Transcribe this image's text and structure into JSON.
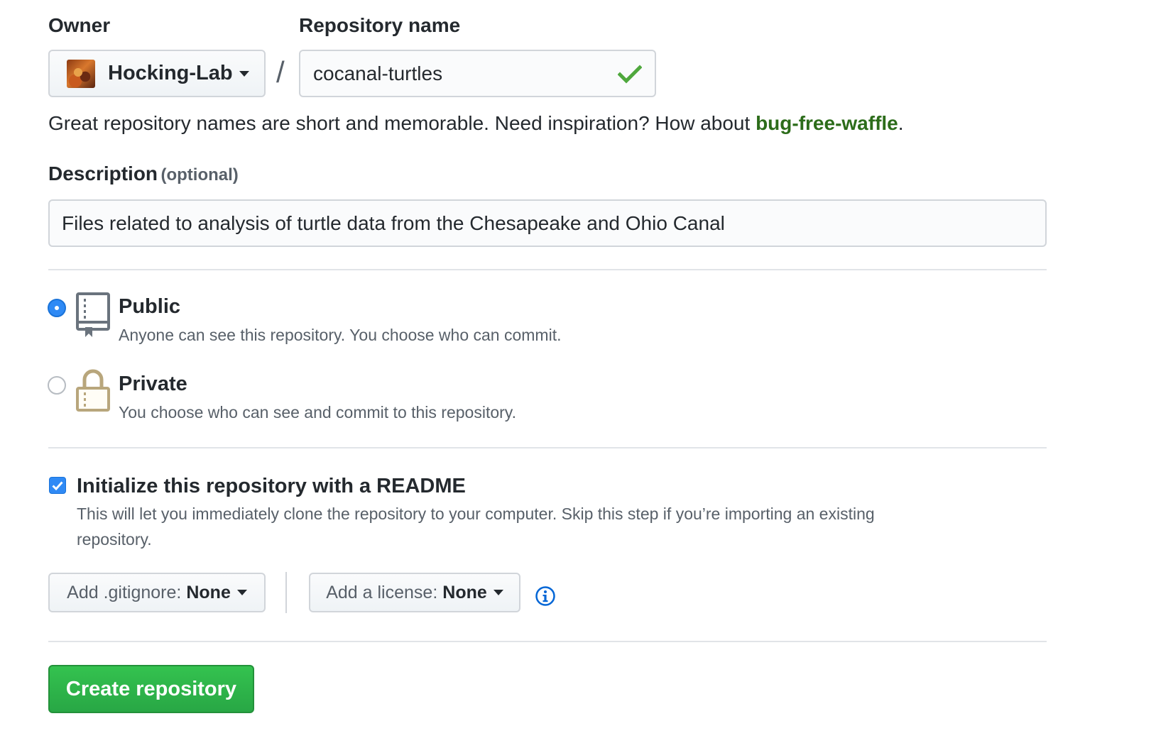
{
  "owner": {
    "label": "Owner",
    "value": "Hocking-Lab"
  },
  "repo": {
    "label": "Repository name",
    "separator": "/",
    "value": "cocanal-turtles",
    "status": "valid"
  },
  "hint": {
    "text": "Great repository names are short and memorable. Need inspiration? How about ",
    "suggestion": "bug-free-waffle",
    "suffix": "."
  },
  "description": {
    "label": "Description",
    "optional": "(optional)",
    "value": "Files related to analysis of turtle data from the Chesapeake and Ohio Canal"
  },
  "visibility": {
    "selected": "Public",
    "options": [
      {
        "title": "Public",
        "desc": "Anyone can see this repository. You choose who can commit.",
        "icon": "repo-icon"
      },
      {
        "title": "Private",
        "desc": "You choose who can see and commit to this repository.",
        "icon": "lock-icon"
      }
    ]
  },
  "readme": {
    "checked": true,
    "label": "Initialize this repository with a README",
    "desc_line1": "This will let you immediately clone the repository to your computer. Skip this step if you’re importing an existing",
    "desc_line2": "repository."
  },
  "gitignore": {
    "label": "Add .gitignore:",
    "value": "None"
  },
  "license": {
    "label": "Add a license:",
    "value": "None"
  },
  "create_button": "Create repository",
  "colors": {
    "primary_green": "#28a745",
    "radio_blue": "#2f8af5",
    "suggestion_green": "#2c6c1a",
    "lock_gold": "#b8a67c",
    "repo_gray": "#6a737d",
    "info_blue": "#0366d6"
  }
}
